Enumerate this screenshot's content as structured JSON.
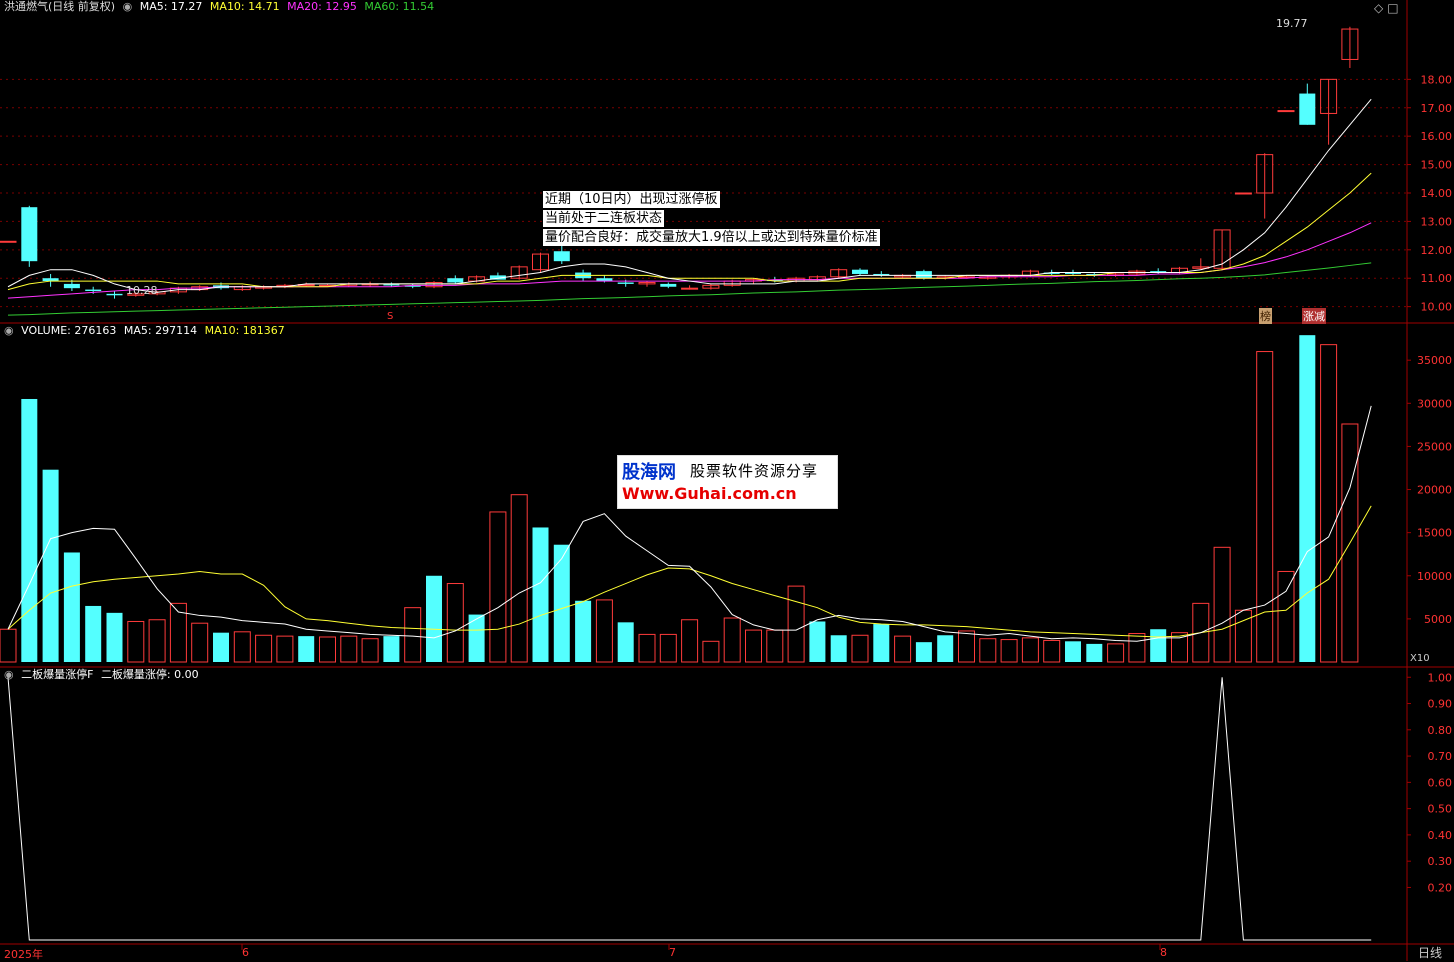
{
  "header_price": {
    "title": "洪通燃气(日线 前复权)",
    "ma5": "MA5: 17.27",
    "ma10": "MA10: 14.71",
    "ma20": "MA20: 12.95",
    "ma60": "MA60: 11.54"
  },
  "header_volume": {
    "title": "VOLUME: 276163",
    "ma5": "MA5: 297114",
    "ma10": "MA10: 181367"
  },
  "header_indicator": {
    "title": "二板爆量涨停F",
    "value": "二板爆量涨停: 0.00"
  },
  "annotations": [
    "近期（10日内）出现过涨停板",
    "当前处于二连板状态",
    "量价配合良好：成交量放大1.9倍以上或达到特殊量价标准"
  ],
  "watermark": {
    "brand": "股海网",
    "slogan": "股票软件资源分享",
    "url": "Www.Guhai.com.cn"
  },
  "labels": {
    "high_price": "19.77",
    "low_price": "10.28",
    "s_marker": "S",
    "tag_bang": "榜",
    "tag_zhangjian": "涨减",
    "vol_unit": "X10",
    "period": "日线"
  },
  "x_axis": [
    "2025年",
    "6",
    "7",
    "8"
  ],
  "colors": {
    "up": "#ff3b3b",
    "down": "#54ffff",
    "ma5": "#ffffff",
    "ma10": "#ffff33",
    "ma20": "#ff33ff",
    "ma60": "#33cc33",
    "axis": "#a00000"
  },
  "chart_data": [
    {
      "type": "candlestick",
      "title": "洪通燃气(日线 前复权)",
      "yticks": [
        "10.00",
        "11.00",
        "12.00",
        "13.00",
        "14.00",
        "15.00",
        "16.00",
        "17.00",
        "18.00"
      ],
      "ylim": [
        9.6,
        20.3
      ],
      "ohlc": [
        [
          12.3,
          12.3,
          12.3,
          12.3
        ],
        [
          13.5,
          13.55,
          11.4,
          11.6
        ],
        [
          11.0,
          11.15,
          10.7,
          10.9
        ],
        [
          10.8,
          10.95,
          10.55,
          10.65
        ],
        [
          10.6,
          10.7,
          10.45,
          10.55
        ],
        [
          10.45,
          10.55,
          10.28,
          10.4
        ],
        [
          10.4,
          10.5,
          10.35,
          10.45
        ],
        [
          10.45,
          10.55,
          10.4,
          10.52
        ],
        [
          10.52,
          10.7,
          10.45,
          10.65
        ],
        [
          10.6,
          10.75,
          10.55,
          10.7
        ],
        [
          10.75,
          10.85,
          10.6,
          10.65
        ],
        [
          10.6,
          10.75,
          10.55,
          10.7
        ],
        [
          10.65,
          10.75,
          10.6,
          10.7
        ],
        [
          10.7,
          10.8,
          10.65,
          10.75
        ],
        [
          10.75,
          10.85,
          10.7,
          10.78
        ],
        [
          10.72,
          10.8,
          10.7,
          10.75
        ],
        [
          10.75,
          10.85,
          10.7,
          10.8
        ],
        [
          10.78,
          10.88,
          10.7,
          10.8
        ],
        [
          10.78,
          10.85,
          10.7,
          10.75
        ],
        [
          10.75,
          10.8,
          10.65,
          10.7
        ],
        [
          10.7,
          10.9,
          10.65,
          10.85
        ],
        [
          11.0,
          11.1,
          10.8,
          10.85
        ],
        [
          10.9,
          11.1,
          10.85,
          11.05
        ],
        [
          11.1,
          11.2,
          10.95,
          10.95
        ],
        [
          11.0,
          11.45,
          10.95,
          11.4
        ],
        [
          11.3,
          11.9,
          11.2,
          11.85
        ],
        [
          11.95,
          12.15,
          11.5,
          11.6
        ],
        [
          11.2,
          11.3,
          10.9,
          11.0
        ],
        [
          11.0,
          11.1,
          10.85,
          10.9
        ],
        [
          10.85,
          10.95,
          10.7,
          10.8
        ],
        [
          10.8,
          10.9,
          10.7,
          10.85
        ],
        [
          10.8,
          10.85,
          10.65,
          10.7
        ],
        [
          10.65,
          10.75,
          10.6,
          10.65
        ],
        [
          10.65,
          10.8,
          10.6,
          10.75
        ],
        [
          10.75,
          10.95,
          10.7,
          10.9
        ],
        [
          10.9,
          11.0,
          10.8,
          10.95
        ],
        [
          10.95,
          11.05,
          10.85,
          10.9
        ],
        [
          10.9,
          11.05,
          10.85,
          11.0
        ],
        [
          10.95,
          11.1,
          10.9,
          11.05
        ],
        [
          11.05,
          11.35,
          11.0,
          11.3
        ],
        [
          11.3,
          11.35,
          11.1,
          11.15
        ],
        [
          11.15,
          11.25,
          11.05,
          11.1
        ],
        [
          11.05,
          11.15,
          11.0,
          11.1
        ],
        [
          11.25,
          11.3,
          10.95,
          11.0
        ],
        [
          11.0,
          11.1,
          10.95,
          11.05
        ],
        [
          11.05,
          11.1,
          11.0,
          11.05
        ],
        [
          11.0,
          11.1,
          10.95,
          11.05
        ],
        [
          11.05,
          11.15,
          11.0,
          11.1
        ],
        [
          11.1,
          11.3,
          11.05,
          11.25
        ],
        [
          11.2,
          11.3,
          11.1,
          11.15
        ],
        [
          11.2,
          11.3,
          11.1,
          11.15
        ],
        [
          11.15,
          11.2,
          11.05,
          11.1
        ],
        [
          11.1,
          11.2,
          11.05,
          11.15
        ],
        [
          11.15,
          11.3,
          11.1,
          11.25
        ],
        [
          11.25,
          11.35,
          11.15,
          11.2
        ],
        [
          11.2,
          11.4,
          11.15,
          11.35
        ],
        [
          11.35,
          11.7,
          11.3,
          11.4
        ],
        [
          11.35,
          12.7,
          11.3,
          12.7
        ],
        [
          14.0,
          14.0,
          14.0,
          14.0
        ],
        [
          14.0,
          15.4,
          13.1,
          15.35
        ],
        [
          16.9,
          16.9,
          16.9,
          16.9
        ],
        [
          17.5,
          17.85,
          16.4,
          16.4
        ],
        [
          16.8,
          18.0,
          15.7,
          18.0
        ],
        [
          18.7,
          19.85,
          18.4,
          19.77
        ]
      ],
      "ma5": [
        10.7,
        11.1,
        11.3,
        11.3,
        11.1,
        10.8,
        10.6,
        10.5,
        10.6,
        10.6,
        10.7,
        10.7,
        10.7,
        10.7,
        10.8,
        10.8,
        10.8,
        10.8,
        10.8,
        10.8,
        10.8,
        10.8,
        10.9,
        11.0,
        11.1,
        11.2,
        11.4,
        11.5,
        11.5,
        11.4,
        11.2,
        11.0,
        10.9,
        10.8,
        10.8,
        10.8,
        10.8,
        10.9,
        10.9,
        11.0,
        11.1,
        11.1,
        11.1,
        11.1,
        11.1,
        11.1,
        11.1,
        11.1,
        11.1,
        11.2,
        11.2,
        11.2,
        11.2,
        11.2,
        11.2,
        11.2,
        11.3,
        11.5,
        12.0,
        12.6,
        13.5,
        14.5,
        15.5,
        16.4,
        17.3
      ],
      "ma10": [
        10.6,
        10.8,
        10.9,
        10.9,
        10.9,
        10.9,
        10.9,
        10.9,
        10.8,
        10.8,
        10.8,
        10.8,
        10.7,
        10.7,
        10.7,
        10.7,
        10.8,
        10.8,
        10.8,
        10.8,
        10.8,
        10.8,
        10.8,
        10.9,
        10.9,
        11.0,
        11.1,
        11.1,
        11.1,
        11.1,
        11.1,
        11.0,
        11.0,
        11.0,
        11.0,
        11.0,
        10.9,
        10.9,
        10.9,
        10.9,
        11.0,
        11.0,
        11.0,
        11.0,
        11.0,
        11.1,
        11.1,
        11.1,
        11.1,
        11.1,
        11.1,
        11.1,
        11.2,
        11.2,
        11.2,
        11.2,
        11.2,
        11.3,
        11.5,
        11.8,
        12.3,
        12.8,
        13.4,
        14.0,
        14.7
      ],
      "ma20": [
        10.3,
        10.35,
        10.4,
        10.45,
        10.5,
        10.55,
        10.6,
        10.6,
        10.65,
        10.65,
        10.7,
        10.7,
        10.7,
        10.7,
        10.7,
        10.7,
        10.7,
        10.7,
        10.7,
        10.75,
        10.75,
        10.75,
        10.8,
        10.8,
        10.8,
        10.85,
        10.9,
        10.9,
        10.9,
        10.9,
        10.9,
        10.9,
        10.9,
        10.9,
        10.9,
        10.9,
        10.95,
        10.95,
        10.95,
        11.0,
        11.0,
        11.0,
        11.0,
        11.0,
        11.0,
        11.0,
        11.05,
        11.05,
        11.05,
        11.05,
        11.1,
        11.1,
        11.1,
        11.1,
        11.15,
        11.15,
        11.2,
        11.3,
        11.4,
        11.55,
        11.75,
        12.0,
        12.3,
        12.6,
        12.95
      ],
      "ma60": [
        9.7,
        9.72,
        9.75,
        9.78,
        9.8,
        9.82,
        9.84,
        9.86,
        9.88,
        9.9,
        9.92,
        9.94,
        9.96,
        9.98,
        10.0,
        10.02,
        10.04,
        10.06,
        10.08,
        10.1,
        10.12,
        10.14,
        10.16,
        10.18,
        10.2,
        10.22,
        10.25,
        10.28,
        10.3,
        10.32,
        10.35,
        10.38,
        10.4,
        10.42,
        10.45,
        10.48,
        10.5,
        10.52,
        10.55,
        10.58,
        10.6,
        10.62,
        10.65,
        10.68,
        10.7,
        10.72,
        10.75,
        10.78,
        10.8,
        10.82,
        10.85,
        10.88,
        10.9,
        10.92,
        10.95,
        10.98,
        11.0,
        11.03,
        11.07,
        11.12,
        11.2,
        11.28,
        11.36,
        11.45,
        11.54
      ]
    },
    {
      "type": "bar",
      "title": "VOLUME",
      "yticks": [
        "5000",
        "10000",
        "15000",
        "20000",
        "25000",
        "30000",
        "35000"
      ],
      "ylim": [
        0,
        38500
      ],
      "unit": "X10",
      "values": [
        3800,
        30500,
        22300,
        12700,
        6500,
        5700,
        4700,
        4900,
        6800,
        4500,
        3400,
        3500,
        3100,
        3000,
        3000,
        2900,
        3000,
        2700,
        3000,
        6300,
        10000,
        9100,
        5500,
        17400,
        19400,
        15600,
        13600,
        7100,
        7200,
        4600,
        3200,
        3200,
        4900,
        2400,
        5100,
        3700,
        3700,
        8800,
        4700,
        3100,
        3100,
        4400,
        3000,
        2300,
        3100,
        3600,
        2700,
        2600,
        2800,
        2500,
        2400,
        2100,
        2100,
        3300,
        3800,
        3400,
        6800,
        13300,
        6000,
        36000,
        10500,
        37900,
        36800,
        27600
      ],
      "up": [
        true,
        false,
        false,
        false,
        false,
        false,
        true,
        true,
        true,
        true,
        false,
        true,
        true,
        true,
        false,
        true,
        true,
        true,
        false,
        true,
        false,
        true,
        false,
        true,
        true,
        false,
        false,
        false,
        true,
        false,
        true,
        true,
        true,
        true,
        true,
        true,
        true,
        true,
        false,
        false,
        true,
        false,
        true,
        false,
        false,
        true,
        true,
        true,
        true,
        true,
        false,
        false,
        true,
        true,
        false,
        true,
        true,
        true,
        true,
        true,
        true,
        false,
        true,
        true
      ],
      "ma5": [
        3800,
        9000,
        14300,
        15000,
        15500,
        15400,
        12000,
        8500,
        5800,
        5400,
        5200,
        4800,
        4600,
        4400,
        3800,
        3600,
        3400,
        3200,
        3100,
        3000,
        2800,
        3600,
        5000,
        6300,
        8000,
        9200,
        12000,
        16300,
        17200,
        14600,
        12900,
        11200,
        11100,
        8700,
        5500,
        4300,
        3700,
        3700,
        4900,
        5400,
        5000,
        4900,
        4700,
        4100,
        3500,
        3300,
        3100,
        3300,
        3000,
        2700,
        2800,
        2700,
        2500,
        2400,
        2800,
        2800,
        3400,
        4500,
        6000,
        6600,
        8200,
        12800,
        14500,
        20200,
        29700
      ],
      "ma10": [
        3800,
        6000,
        8000,
        8800,
        9300,
        9600,
        9800,
        10000,
        10200,
        10500,
        10200,
        10200,
        8900,
        6400,
        5000,
        4800,
        4500,
        4200,
        4000,
        3900,
        3800,
        3700,
        3700,
        3800,
        4400,
        5400,
        6200,
        7000,
        8100,
        9100,
        10100,
        10900,
        10800,
        10000,
        9100,
        8400,
        7700,
        7000,
        6300,
        5200,
        4600,
        4400,
        4300,
        4300,
        4200,
        4100,
        3900,
        3700,
        3500,
        3400,
        3300,
        3200,
        3100,
        3000,
        2900,
        3000,
        3400,
        3800,
        4800,
        5800,
        6000,
        8000,
        9600,
        13800,
        18100
      ]
    },
    {
      "type": "line",
      "title": "二板爆量涨停F",
      "yticks": [
        "0.20",
        "0.30",
        "0.40",
        "0.50",
        "0.60",
        "0.70",
        "0.80",
        "0.90",
        "1.00"
      ],
      "ylim": [
        0,
        1.02
      ],
      "values": [
        1,
        0,
        0,
        0,
        0,
        0,
        0,
        0,
        0,
        0,
        0,
        0,
        0,
        0,
        0,
        0,
        0,
        0,
        0,
        0,
        0,
        0,
        0,
        0,
        0,
        0,
        0,
        0,
        0,
        0,
        0,
        0,
        0,
        0,
        0,
        0,
        0,
        0,
        0,
        0,
        0,
        0,
        0,
        0,
        0,
        0,
        0,
        0,
        0,
        0,
        0,
        0,
        0,
        0,
        0,
        0,
        0,
        1,
        0,
        0,
        0,
        0,
        0,
        0,
        0
      ]
    }
  ]
}
